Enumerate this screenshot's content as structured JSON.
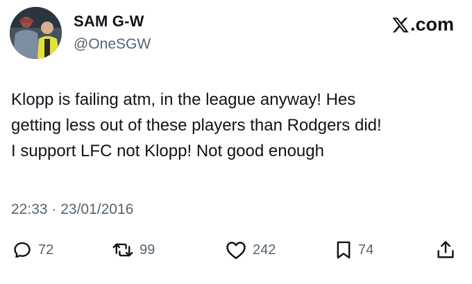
{
  "author": {
    "name": "SAM G-W",
    "handle": "@OneSGW"
  },
  "brand": {
    "label": ".com",
    "icon": "x-logo-icon"
  },
  "tweet": {
    "lines": [
      "Klopp is failing atm, in the league anyway! Hes",
      "getting less out of these players than Rodgers did!",
      "I support LFC not Klopp! Not good enough"
    ],
    "timestamp": "22:33 · 23/01/2016"
  },
  "actions": {
    "replies": {
      "icon": "reply-icon",
      "count": "72"
    },
    "reposts": {
      "icon": "repost-icon",
      "count": "99"
    },
    "likes": {
      "icon": "like-icon",
      "count": "242"
    },
    "bookmarks": {
      "icon": "bookmark-icon",
      "count": "74"
    },
    "share": {
      "icon": "share-icon"
    }
  },
  "colors": {
    "text": "#0f1419",
    "secondary": "#536471",
    "background": "#ffffff"
  }
}
